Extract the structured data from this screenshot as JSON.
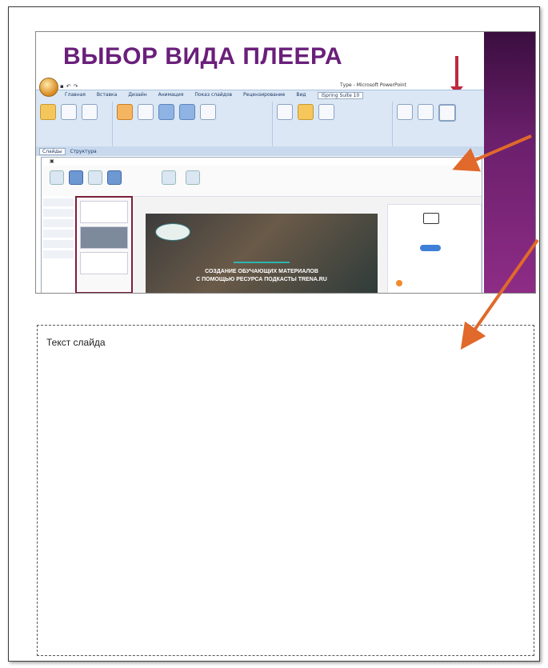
{
  "slide": {
    "title": "ВЫБОР ВИДА ПЛЕЕРА",
    "powerpoint": {
      "window_title": "Туре - Microsoft PowerPoint",
      "tabs": [
        "Главная",
        "Вставка",
        "Дизайн",
        "Анимация",
        "Показ слайдов",
        "Рецензирование",
        "Вид",
        "iSpring Suite 10"
      ],
      "active_tab": "iSpring Suite 10",
      "side_tabs": [
        "Слайды",
        "Структура"
      ]
    },
    "preview_window": {
      "headline_line1": "СОЗДАНИЕ ОБУЧАЮЩИХ МАТЕРИАЛОВ",
      "headline_line2": "С ПОМОЩЬЮ РЕСУРСА ПОДКАСТЫ TRENA.RU"
    }
  },
  "notes": {
    "placeholder": "Текст слайда"
  },
  "colors": {
    "accent_arrow": "#e0692b",
    "title_purple": "#6a1f7a",
    "frame_red": "#7a1f3a"
  }
}
